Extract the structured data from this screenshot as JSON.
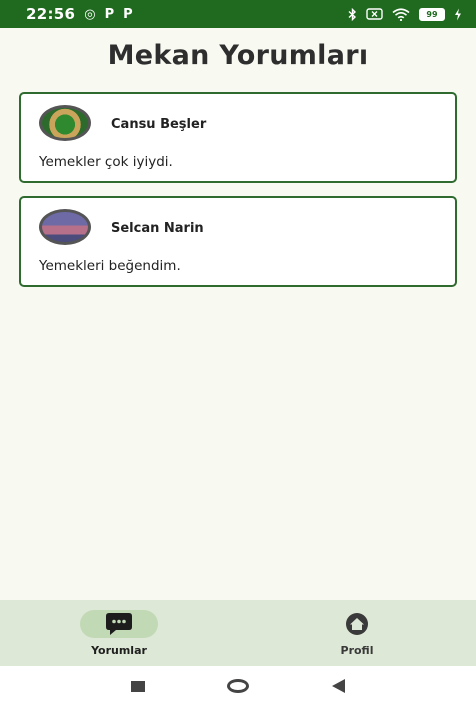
{
  "status_bar": {
    "time": "22:56",
    "app_icons": [
      "whatsapp-icon",
      "p-icon",
      "p-icon"
    ],
    "app_glyphs": [
      "◎",
      "P",
      "P"
    ],
    "battery": "99",
    "right_icons": [
      "bluetooth-icon",
      "sim-icon",
      "wifi-icon",
      "battery-icon",
      "charging-icon"
    ]
  },
  "page": {
    "title": "Mekan Yorumları"
  },
  "reviews": [
    {
      "name": "Cansu Beşler",
      "text": "Yemekler çok iyiydi.",
      "avatar": "forest-logo"
    },
    {
      "name": "Selcan Narin",
      "text": "Yemekleri beğendim.",
      "avatar": "person-photo"
    }
  ],
  "bottom_nav": {
    "items": [
      {
        "label": "Yorumlar",
        "icon": "chat-bubble-icon",
        "active": true
      },
      {
        "label": "Profil",
        "icon": "home-icon",
        "active": false
      }
    ]
  },
  "colors": {
    "status_bar": "#1f6a1f",
    "card_border": "#2f6a2f",
    "nav_background": "#dde8d6",
    "nav_active_pill": "#c2d9b6"
  }
}
